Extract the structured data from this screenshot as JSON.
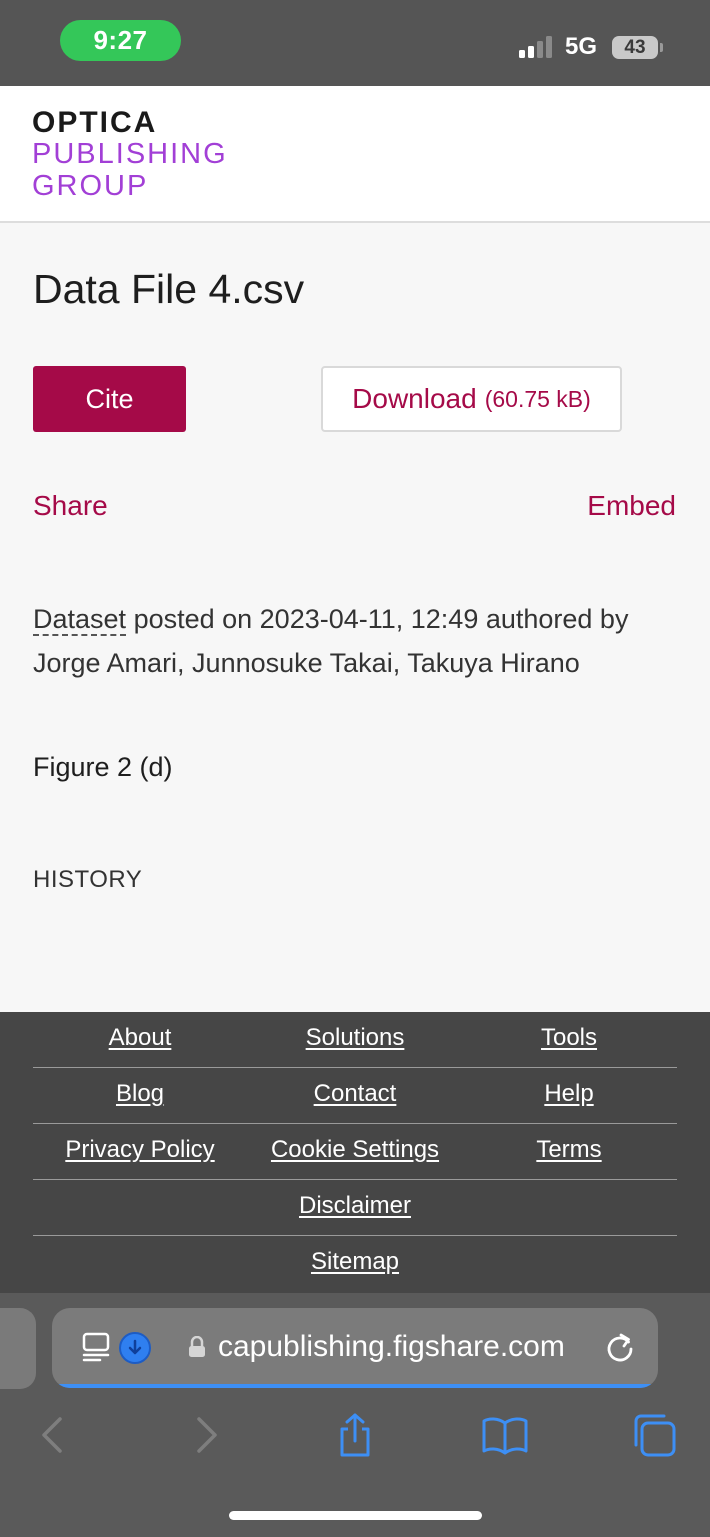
{
  "status_bar": {
    "time": "9:27",
    "network": "5G",
    "battery": "43",
    "time_pill_color": "#34c759"
  },
  "header": {
    "logo_line1": "OPTICA",
    "logo_line2": "PUBLISHING",
    "logo_line3": "GROUP",
    "logo_accent_color": "#a23fd6"
  },
  "item": {
    "title": "Data File 4.csv",
    "cite_label": "Cite",
    "download_label": "Download",
    "download_size": "(60.75 kB)",
    "share_label": "Share",
    "embed_label": "Embed",
    "item_type": "Dataset",
    "posted_text": " posted on 2023-04-11, 12:49 authored by Jorge Amari, Junnosuke Takai, Takuya Hirano",
    "description": "Figure 2 (d)",
    "history_label": "HISTORY",
    "accent_color": "#a50a48"
  },
  "footer": {
    "rows": [
      [
        "About",
        "Solutions",
        "Tools"
      ],
      [
        "Blog",
        "Contact",
        "Help"
      ],
      [
        "Privacy Policy",
        "Cookie Settings",
        "Terms"
      ],
      [
        "Disclaimer"
      ],
      [
        "Sitemap"
      ]
    ]
  },
  "browser": {
    "url": "capublishing.figshare.com",
    "toolbar_icons": [
      "back-icon",
      "forward-icon",
      "share-icon",
      "bookmarks-icon",
      "tabs-icon"
    ],
    "accent_color": "#3d8ff5"
  }
}
